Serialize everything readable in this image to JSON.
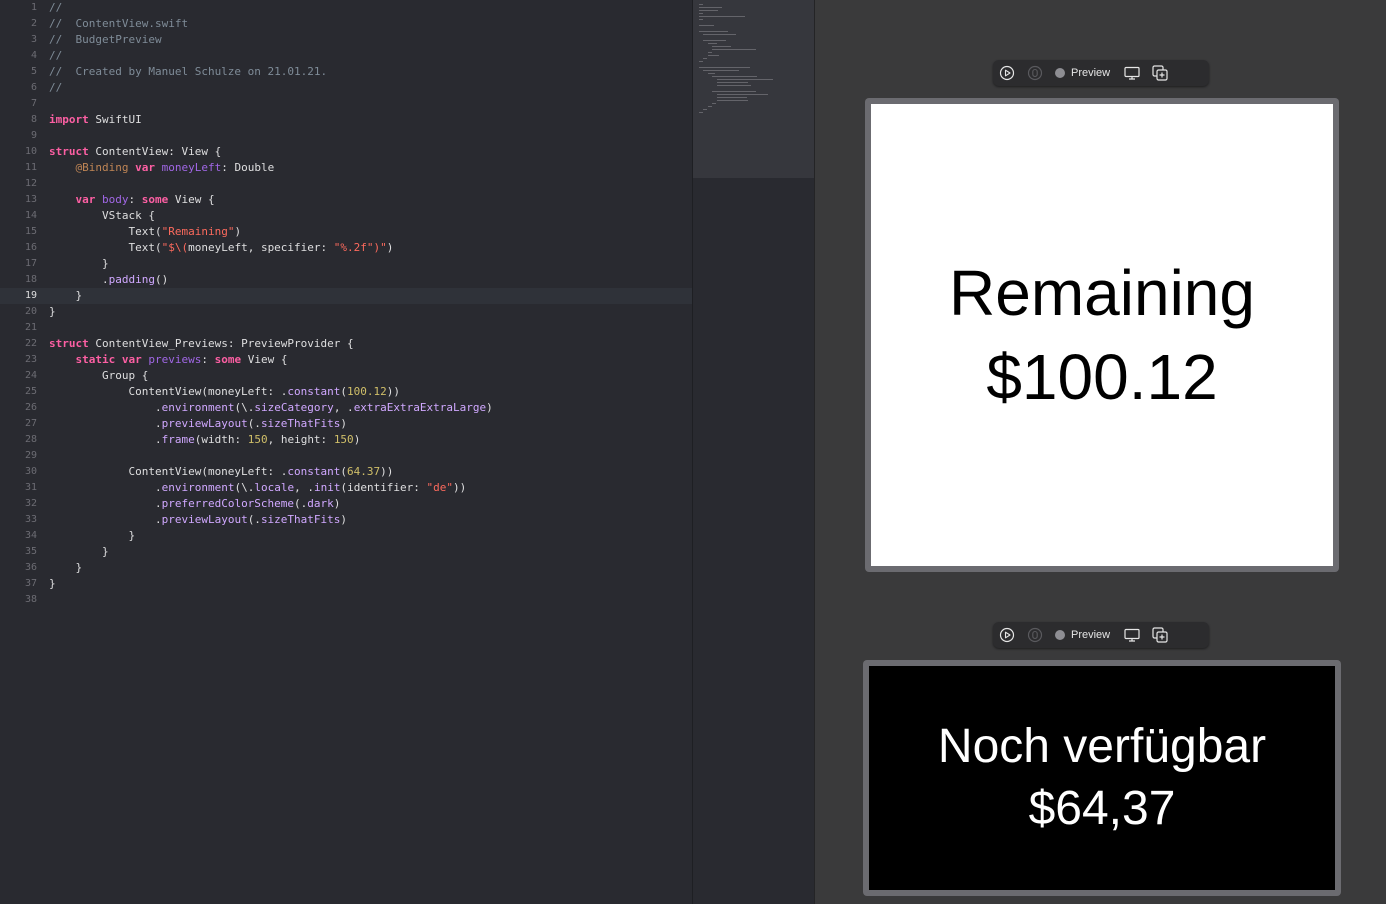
{
  "editor": {
    "current_line": 19,
    "lines": [
      [
        {
          "c": "comment",
          "t": "//"
        }
      ],
      [
        {
          "c": "comment",
          "t": "//  ContentView.swift"
        }
      ],
      [
        {
          "c": "comment",
          "t": "//  BudgetPreview"
        }
      ],
      [
        {
          "c": "comment",
          "t": "//"
        }
      ],
      [
        {
          "c": "comment",
          "t": "//  Created by Manuel Schulze on 21.01.21."
        }
      ],
      [
        {
          "c": "comment",
          "t": "//"
        }
      ],
      [],
      [
        {
          "c": "kw",
          "t": "import"
        },
        {
          "c": "plain",
          "t": " SwiftUI"
        }
      ],
      [],
      [
        {
          "c": "kw",
          "t": "struct"
        },
        {
          "c": "plain",
          "t": " ContentView: View {"
        }
      ],
      [
        {
          "c": "plain",
          "t": "    "
        },
        {
          "c": "attr",
          "t": "@Binding"
        },
        {
          "c": "plain",
          "t": " "
        },
        {
          "c": "kw",
          "t": "var"
        },
        {
          "c": "plain",
          "t": " "
        },
        {
          "c": "prop",
          "t": "moneyLeft"
        },
        {
          "c": "plain",
          "t": ": Double"
        }
      ],
      [],
      [
        {
          "c": "plain",
          "t": "    "
        },
        {
          "c": "kw",
          "t": "var"
        },
        {
          "c": "plain",
          "t": " "
        },
        {
          "c": "prop",
          "t": "body"
        },
        {
          "c": "plain",
          "t": ": "
        },
        {
          "c": "kw",
          "t": "some"
        },
        {
          "c": "plain",
          "t": " View {"
        }
      ],
      [
        {
          "c": "plain",
          "t": "        VStack {"
        }
      ],
      [
        {
          "c": "plain",
          "t": "            Text("
        },
        {
          "c": "str",
          "t": "\"Remaining\""
        },
        {
          "c": "plain",
          "t": ")"
        }
      ],
      [
        {
          "c": "plain",
          "t": "            Text("
        },
        {
          "c": "str",
          "t": "\"$\\("
        },
        {
          "c": "plain",
          "t": "moneyLeft, specifier: "
        },
        {
          "c": "str",
          "t": "\"%.2f\""
        },
        {
          "c": "str",
          "t": ")\""
        },
        {
          "c": "plain",
          "t": ")"
        }
      ],
      [
        {
          "c": "plain",
          "t": "        }"
        }
      ],
      [
        {
          "c": "plain",
          "t": "        ."
        },
        {
          "c": "type",
          "t": "padding"
        },
        {
          "c": "plain",
          "t": "()"
        }
      ],
      [
        {
          "c": "plain",
          "t": "    }"
        }
      ],
      [
        {
          "c": "plain",
          "t": "}"
        }
      ],
      [],
      [
        {
          "c": "kw",
          "t": "struct"
        },
        {
          "c": "plain",
          "t": " ContentView_Previews: PreviewProvider {"
        }
      ],
      [
        {
          "c": "plain",
          "t": "    "
        },
        {
          "c": "kw",
          "t": "static"
        },
        {
          "c": "plain",
          "t": " "
        },
        {
          "c": "kw",
          "t": "var"
        },
        {
          "c": "plain",
          "t": " "
        },
        {
          "c": "prop",
          "t": "previews"
        },
        {
          "c": "plain",
          "t": ": "
        },
        {
          "c": "kw",
          "t": "some"
        },
        {
          "c": "plain",
          "t": " View {"
        }
      ],
      [
        {
          "c": "plain",
          "t": "        Group {"
        }
      ],
      [
        {
          "c": "plain",
          "t": "            ContentView(moneyLeft: ."
        },
        {
          "c": "type",
          "t": "constant"
        },
        {
          "c": "plain",
          "t": "("
        },
        {
          "c": "num",
          "t": "100.12"
        },
        {
          "c": "plain",
          "t": "))"
        }
      ],
      [
        {
          "c": "plain",
          "t": "                ."
        },
        {
          "c": "type",
          "t": "environment"
        },
        {
          "c": "plain",
          "t": "(\\."
        },
        {
          "c": "type",
          "t": "sizeCategory"
        },
        {
          "c": "plain",
          "t": ", ."
        },
        {
          "c": "type",
          "t": "extraExtraExtraLarge"
        },
        {
          "c": "plain",
          "t": ")"
        }
      ],
      [
        {
          "c": "plain",
          "t": "                ."
        },
        {
          "c": "type",
          "t": "previewLayout"
        },
        {
          "c": "plain",
          "t": "(."
        },
        {
          "c": "type",
          "t": "sizeThatFits"
        },
        {
          "c": "plain",
          "t": ")"
        }
      ],
      [
        {
          "c": "plain",
          "t": "                ."
        },
        {
          "c": "type",
          "t": "frame"
        },
        {
          "c": "plain",
          "t": "(width: "
        },
        {
          "c": "num",
          "t": "150"
        },
        {
          "c": "plain",
          "t": ", height: "
        },
        {
          "c": "num",
          "t": "150"
        },
        {
          "c": "plain",
          "t": ")"
        }
      ],
      [],
      [
        {
          "c": "plain",
          "t": "            ContentView(moneyLeft: ."
        },
        {
          "c": "type",
          "t": "constant"
        },
        {
          "c": "plain",
          "t": "("
        },
        {
          "c": "num",
          "t": "64.37"
        },
        {
          "c": "plain",
          "t": "))"
        }
      ],
      [
        {
          "c": "plain",
          "t": "                ."
        },
        {
          "c": "type",
          "t": "environment"
        },
        {
          "c": "plain",
          "t": "(\\."
        },
        {
          "c": "type",
          "t": "locale"
        },
        {
          "c": "plain",
          "t": ", ."
        },
        {
          "c": "type",
          "t": "init"
        },
        {
          "c": "plain",
          "t": "(identifier: "
        },
        {
          "c": "str",
          "t": "\"de\""
        },
        {
          "c": "plain",
          "t": "))"
        }
      ],
      [
        {
          "c": "plain",
          "t": "                ."
        },
        {
          "c": "type",
          "t": "preferredColorScheme"
        },
        {
          "c": "plain",
          "t": "(."
        },
        {
          "c": "type",
          "t": "dark"
        },
        {
          "c": "plain",
          "t": ")"
        }
      ],
      [
        {
          "c": "plain",
          "t": "                ."
        },
        {
          "c": "type",
          "t": "previewLayout"
        },
        {
          "c": "plain",
          "t": "(."
        },
        {
          "c": "type",
          "t": "sizeThatFits"
        },
        {
          "c": "plain",
          "t": ")"
        }
      ],
      [
        {
          "c": "plain",
          "t": "            }"
        }
      ],
      [
        {
          "c": "plain",
          "t": "        }"
        }
      ],
      [
        {
          "c": "plain",
          "t": "    }"
        }
      ],
      [
        {
          "c": "plain",
          "t": "}"
        }
      ],
      []
    ]
  },
  "canvas": {
    "preview_label": "Preview",
    "previews": [
      {
        "title": "Remaining",
        "amount": "$100.12",
        "scheme": "light"
      },
      {
        "title": "Noch verfügbar",
        "amount": "$64,37",
        "scheme": "dark"
      }
    ]
  },
  "icons": {
    "live": "play-circle-icon",
    "inspect": "inspect-icon",
    "device": "device-icon",
    "duplicate": "duplicate-icon"
  }
}
